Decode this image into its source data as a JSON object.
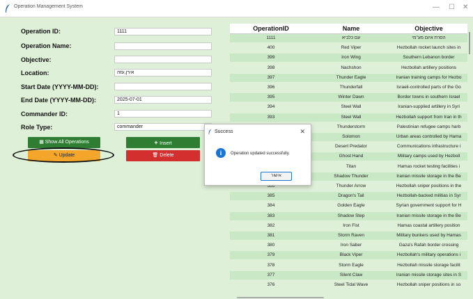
{
  "window": {
    "title": "Operation Management System",
    "minimize": "—",
    "maximize": "☐",
    "close": "✕"
  },
  "form": {
    "fields": [
      {
        "label": "Operation ID:",
        "value": "1111"
      },
      {
        "label": "Operation Name:",
        "value": ""
      },
      {
        "label": "Objective:",
        "value": ""
      },
      {
        "label": "Location:",
        "value": "אירן,עזה"
      },
      {
        "label": "Start Date (YYYY-MM-DD):",
        "value": ""
      },
      {
        "label": "End Date (YYYY-MM-DD):",
        "value": "2025-07-01"
      },
      {
        "label": "Commander ID:",
        "value": "1"
      },
      {
        "label": "Role Type:",
        "value": "commander"
      }
    ]
  },
  "buttons": {
    "show_all": "Show All Operations",
    "insert": "Insert",
    "update": "Update",
    "delete": "Delete"
  },
  "colors": {
    "background": "#dff0d8",
    "green": "#2e7d32",
    "orange": "#f4a62a",
    "red": "#d32f2f",
    "info": "#1976d2"
  },
  "table": {
    "headers": [
      "OperationID",
      "Name",
      "Objective"
    ],
    "rows": [
      [
        "1111",
        "עם כלביא",
        "הסרת איום מע\"מי"
      ],
      [
        "400",
        "Red Viper",
        "Hezbollah rocket launch sites in"
      ],
      [
        "399",
        "Iron Wing",
        "Southern Lebanon border"
      ],
      [
        "398",
        "Nachshon",
        "Hezbollah artillery positions"
      ],
      [
        "397",
        "Thunder Eagle",
        "Iranian training camps for Hezbo"
      ],
      [
        "396",
        "Thunderfall",
        "Israeli-controlled parts of the Go"
      ],
      [
        "395",
        "Winter Dawn",
        "Border towns in southern Israel"
      ],
      [
        "394",
        "Steel Wall",
        "Iranian-supplied artillery in Syri"
      ],
      [
        "393",
        "Steel Wall",
        "Hezbollah support from Iran in th"
      ],
      [
        "",
        "Thunderstorm",
        "Palestinian refugee camps harb"
      ],
      [
        "",
        "Solomon",
        "Urban areas controlled by Hama"
      ],
      [
        "",
        "Desert Predator",
        "Communications infrastructure i"
      ],
      [
        "",
        "Ghost Hand",
        "Military camps used by Hezboll"
      ],
      [
        "",
        "Titan",
        "Hamas rocket testing facilities i"
      ],
      [
        "",
        "Shadow Thunder",
        "Iranian missile storage in the Be"
      ],
      [
        "386",
        "Thunder Arrow",
        "Hezbollah sniper positions in the"
      ],
      [
        "385",
        "Dragon's Tail",
        "Hezbollah-backed militias in Syr"
      ],
      [
        "384",
        "Golden Eagle",
        "Syrian government support for H"
      ],
      [
        "383",
        "Shadow Step",
        "Iranian missile storage in the Be"
      ],
      [
        "382",
        "Iron Fist",
        "Hamas coastal artillery position"
      ],
      [
        "381",
        "Storm Raven",
        "Military bunkers used by Hamas"
      ],
      [
        "380",
        "Iron Saber",
        "Gaza's Rafah border crossing"
      ],
      [
        "379",
        "Black Viper",
        "Hezbollah's military operations i"
      ],
      [
        "378",
        "Storm Eagle",
        "Hezbollah missile storage facilit"
      ],
      [
        "377",
        "Silent Claw",
        "Iranian missile storage sites in S"
      ],
      [
        "376",
        "Steel Tidal Wave",
        "Hezbollah sniper positions in so"
      ]
    ]
  },
  "dialog": {
    "title": "Success",
    "message": "Operation updated successfully.",
    "ok": "אישור",
    "close": "✕",
    "icon": "i"
  }
}
